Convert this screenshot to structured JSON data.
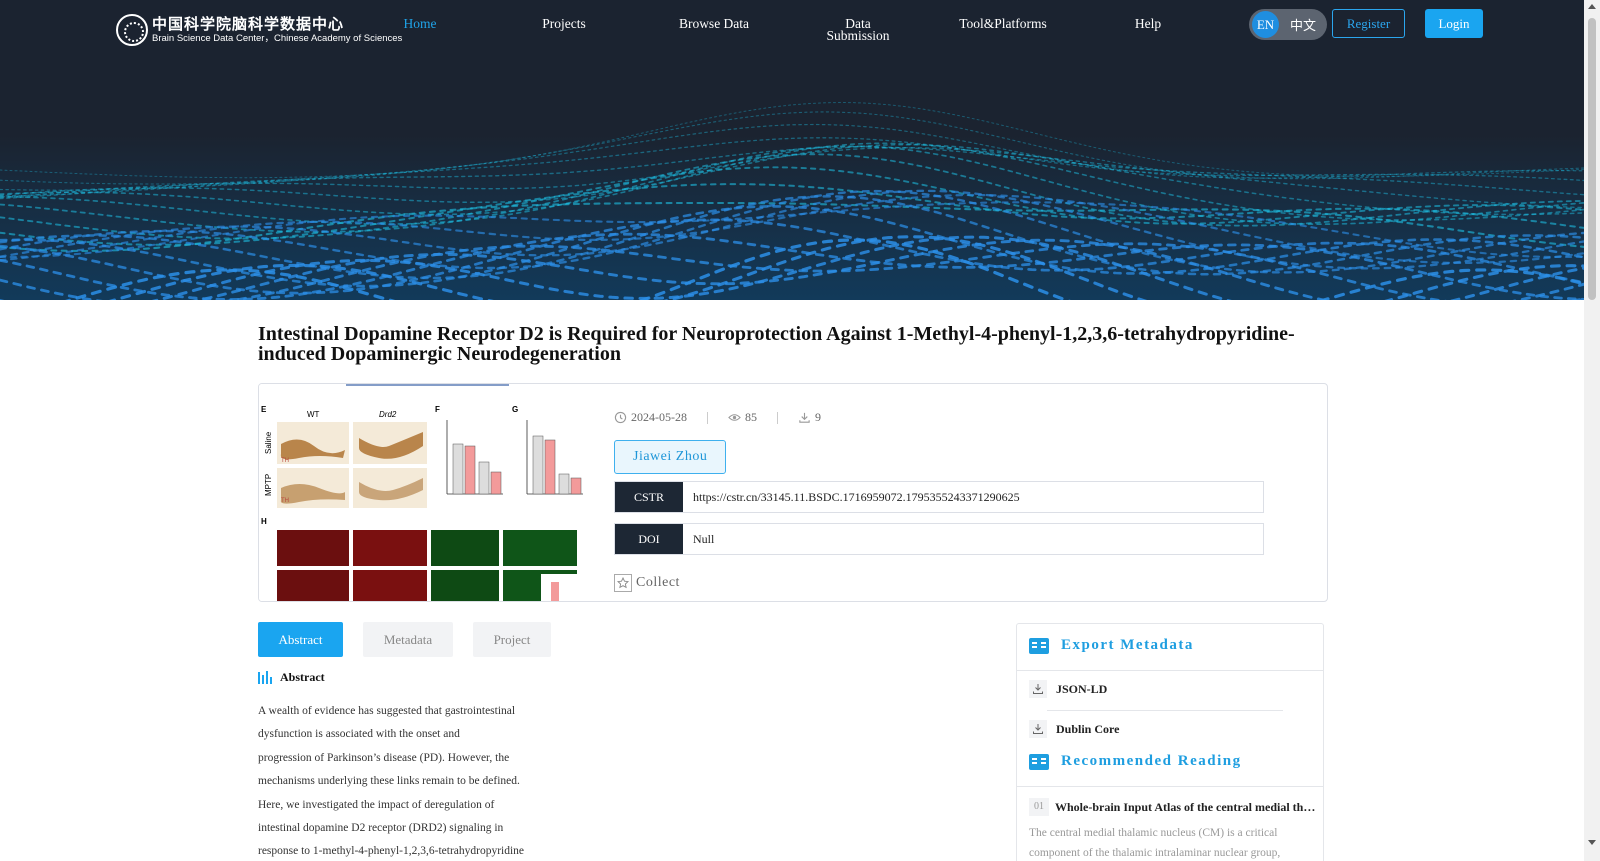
{
  "nav": {
    "logo_cn": "中国科学院脑科学数据中心",
    "logo_en": "Brain Science Data Center，Chinese Academy of Sciences",
    "items": [
      {
        "label": "Home"
      },
      {
        "label": "Projects"
      },
      {
        "label": "Browse Data"
      },
      {
        "label_line1": "Data",
        "label_line2": "Submission"
      },
      {
        "label": "Tool&Platforms"
      },
      {
        "label": "Help"
      }
    ],
    "lang_en": "EN",
    "lang_zh": "中文",
    "register": "Register",
    "login": "Login"
  },
  "dataset": {
    "title": "Intestinal Dopamine Receptor D2 is Required for Neuroprotection Against 1-Methyl-4-phenyl-1,2,3,6-tetrahydropyridine-induced Dopaminergic Neurodegeneration",
    "date": "2024-05-28",
    "views": "85",
    "downloads": "9",
    "author": "Jiawei Zhou",
    "cstr_label": "CSTR",
    "cstr_value": "https://cstr.cn/33145.11.BSDC.1716959072.1795355243371290625",
    "doi_label": "DOI",
    "doi_value": "Null",
    "collect": "Collect",
    "figure": {
      "panel_e": "E",
      "panel_f": "F",
      "panel_g": "G",
      "panel_h": "H",
      "wt": "WT",
      "drd2": "Drd2",
      "saline": "Saline",
      "mptp": "MPTP",
      "th": "TH"
    }
  },
  "tabs": [
    {
      "label": "Abstract"
    },
    {
      "label": "Metadata"
    },
    {
      "label": "Project"
    }
  ],
  "abstract": {
    "heading": "Abstract",
    "lines": [
      "A wealth of evidence has suggested that gastrointestinal",
      "dysfunction is associated with the onset and",
      "progression of Parkinson’s disease (PD). However, the",
      "mechanisms underlying these links remain to be defined.",
      "Here, we investigated the impact of deregulation of",
      "intestinal dopamine D2 receptor (DRD2) signaling in",
      "response to 1-methyl-4-phenyl-1,2,3,6-tetrahydropyridine"
    ]
  },
  "side": {
    "export_title": "Export Metadata",
    "json_ld": "JSON-LD",
    "dublin_core": "Dublin Core",
    "rec_title": "Recommended Reading",
    "rec_item_num": "01",
    "rec_item_title": "Whole-brain Input Atlas of the central medial thalamic nucleus",
    "rec_item_desc1": "The central medial thalamic nucleus (CM) is a critical",
    "rec_item_desc2": "component of the thalamic intralaminar nuclear group,"
  }
}
